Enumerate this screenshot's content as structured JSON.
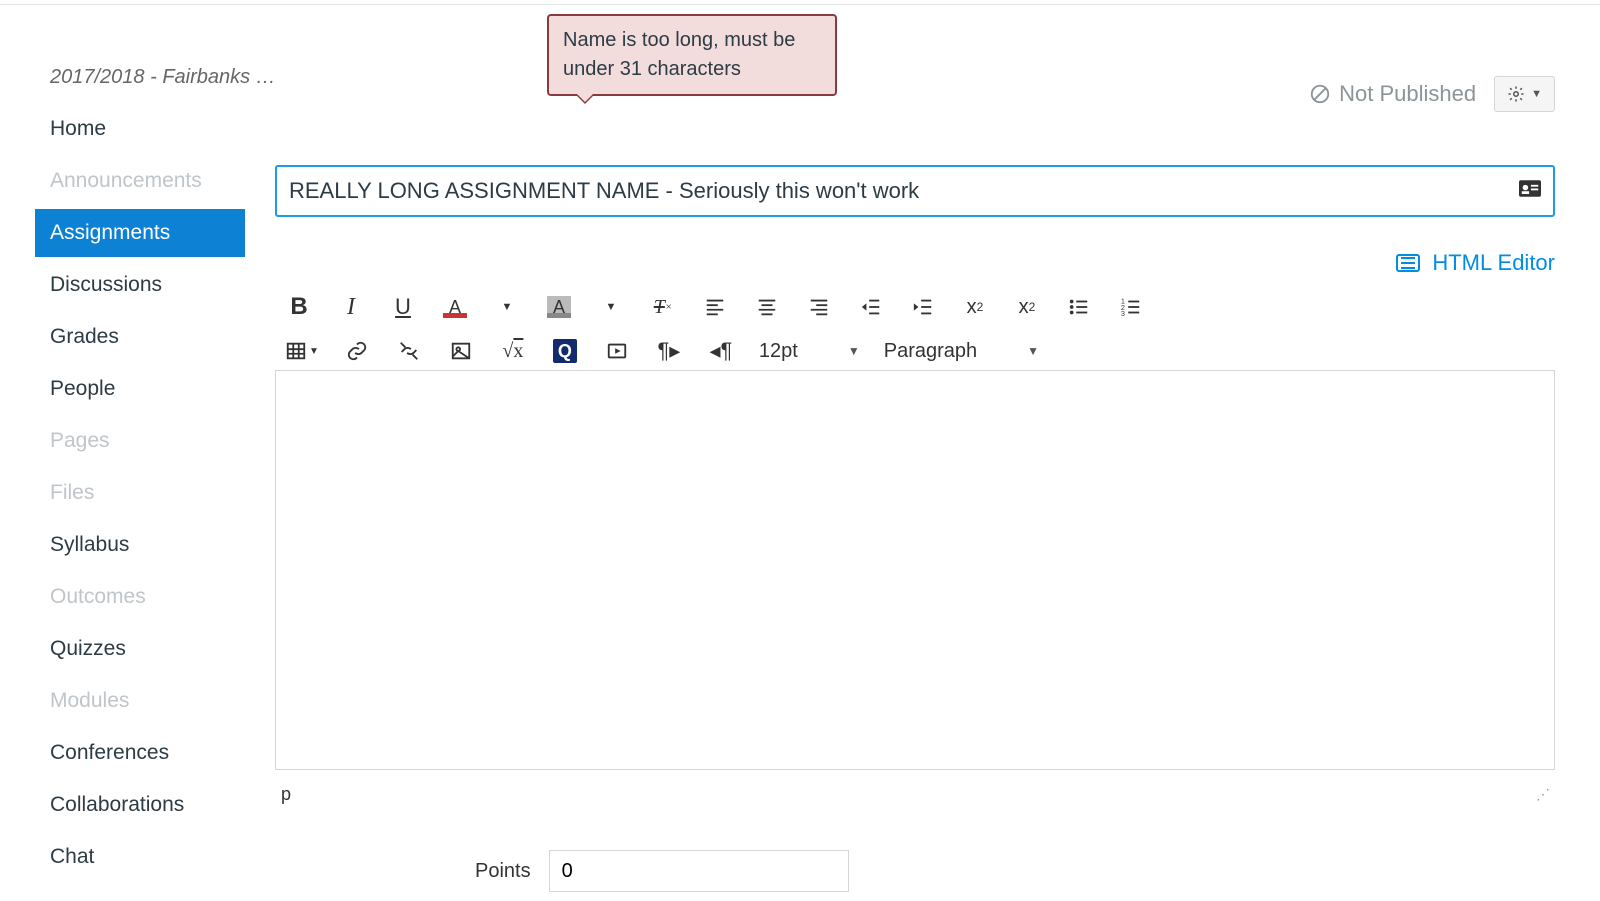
{
  "breadcrumb": "2017/2018 - Fairbanks …",
  "tooltip": "Name is too long, must be under 31 characters",
  "header": {
    "not_published": "Not Published"
  },
  "sidebar": {
    "items": [
      {
        "label": "Home",
        "state": "normal"
      },
      {
        "label": "Announcements",
        "state": "disabled"
      },
      {
        "label": "Assignments",
        "state": "active"
      },
      {
        "label": "Discussions",
        "state": "normal"
      },
      {
        "label": "Grades",
        "state": "normal"
      },
      {
        "label": "People",
        "state": "normal"
      },
      {
        "label": "Pages",
        "state": "disabled"
      },
      {
        "label": "Files",
        "state": "disabled"
      },
      {
        "label": "Syllabus",
        "state": "normal"
      },
      {
        "label": "Outcomes",
        "state": "disabled"
      },
      {
        "label": "Quizzes",
        "state": "normal"
      },
      {
        "label": "Modules",
        "state": "disabled"
      },
      {
        "label": "Conferences",
        "state": "normal"
      },
      {
        "label": "Collaborations",
        "state": "normal"
      },
      {
        "label": "Chat",
        "state": "normal"
      }
    ]
  },
  "assignment": {
    "name_value": "REALLY LONG ASSIGNMENT NAME - Seriously this won't work"
  },
  "editor": {
    "toggle_label": "HTML Editor",
    "font_size": "12pt",
    "block_format": "Paragraph",
    "status_path": "p"
  },
  "points": {
    "label": "Points",
    "value": "0"
  }
}
